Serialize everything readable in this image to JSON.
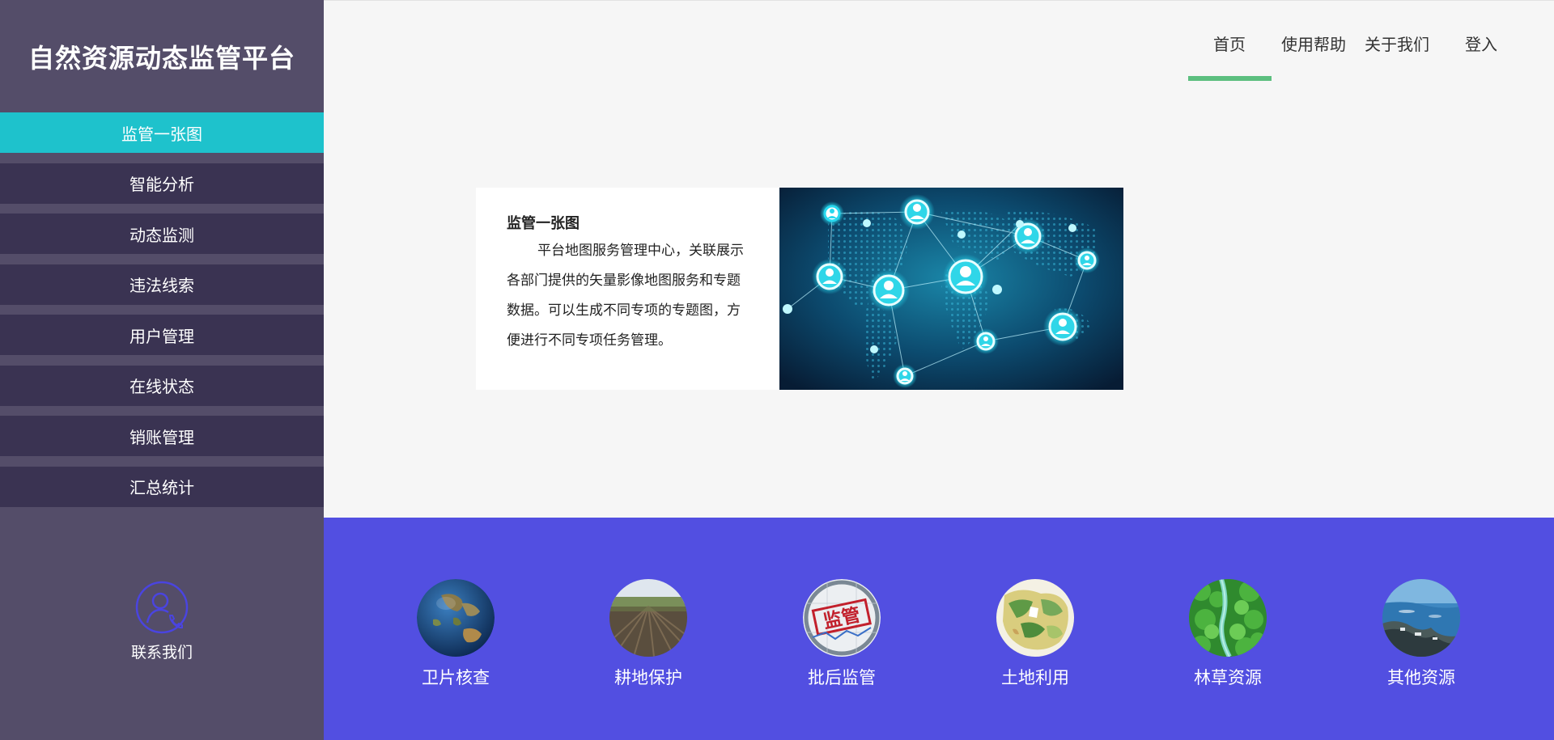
{
  "app": {
    "title": "自然资源动态监管平台"
  },
  "nav": {
    "items": [
      {
        "label": "首页",
        "active": true
      },
      {
        "label": "使用帮助"
      },
      {
        "label": "关于我们"
      },
      {
        "label": "登入"
      }
    ]
  },
  "sidebar": {
    "items": [
      {
        "label": "监管一张图",
        "active": true
      },
      {
        "label": "智能分析"
      },
      {
        "label": "动态监测"
      },
      {
        "label": "违法线索"
      },
      {
        "label": "用户管理"
      },
      {
        "label": "在线状态"
      },
      {
        "label": "销账管理"
      },
      {
        "label": "汇总统计"
      }
    ],
    "contact": {
      "label": "联系我们",
      "icon": "contact-person-phone-icon"
    }
  },
  "intro": {
    "title": "监管一张图",
    "description": "平台地图服务管理中心，关联展示各部门提供的矢量影像地图服务和专题数据。可以生成不同专项的专题图，方便进行不同专项任务管理。",
    "image": "network-world-map-image"
  },
  "modules": [
    {
      "label": "卫片核查",
      "icon": "globe-image"
    },
    {
      "label": "耕地保护",
      "icon": "farmland-image"
    },
    {
      "label": "批后监管",
      "icon": "supervision-stamp-image",
      "stamp": "监管"
    },
    {
      "label": "土地利用",
      "icon": "land-map-image"
    },
    {
      "label": "林草资源",
      "icon": "forest-river-image"
    },
    {
      "label": "其他资源",
      "icon": "coast-image"
    }
  ],
  "colors": {
    "sidebar": "#544d69",
    "menu": "#3a3352",
    "active": "#1ec2cc",
    "band": "#524fe1",
    "underline": "#5cbf7f"
  }
}
